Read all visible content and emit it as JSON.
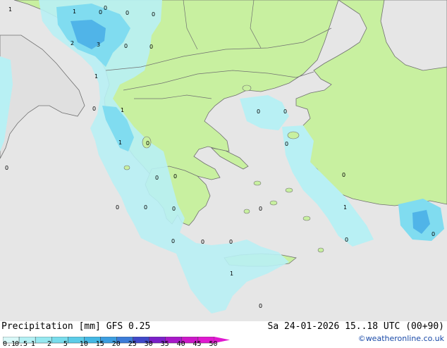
{
  "header": {
    "title": "Precipitation [mm]",
    "model": "GFS 0.25",
    "datetime": "Sa 24-01-2026 15..18 UTC (00+90)",
    "credit": "©weatheronline.co.uk"
  },
  "legend": {
    "ticks": [
      "0.1",
      "0.5",
      "1",
      "2",
      "5",
      "10",
      "15",
      "20",
      "25",
      "30",
      "35",
      "40",
      "45",
      "50"
    ],
    "colors": [
      "#d8f8f8",
      "#b4f0f4",
      "#96e8f0",
      "#78dcec",
      "#5ccce8",
      "#44b8e4",
      "#3c9ee0",
      "#3c7cd8",
      "#4048c8",
      "#7a20c8",
      "#a818c8",
      "#cc18c8",
      "#e018d0"
    ]
  },
  "colors": {
    "sea": "#e6e6e6",
    "land_dry": "#c8f0a0",
    "land_outside": "#e0e0e0",
    "precip_light": "#b8f0f4",
    "precip_medium": "#80dcf0",
    "precip_heavy": "#50b4e8",
    "border": "#707070"
  },
  "map_labels": [
    "1",
    "1",
    "0",
    "0",
    "2",
    "3",
    "0",
    "0",
    "1",
    "0",
    "1",
    "1",
    "0",
    "0",
    "0",
    "0",
    "0",
    "0",
    "0",
    "0",
    "0",
    "0",
    "0",
    "0",
    "0",
    "0",
    "1",
    "0",
    "0",
    "1",
    "0",
    "0",
    "0",
    "0"
  ]
}
